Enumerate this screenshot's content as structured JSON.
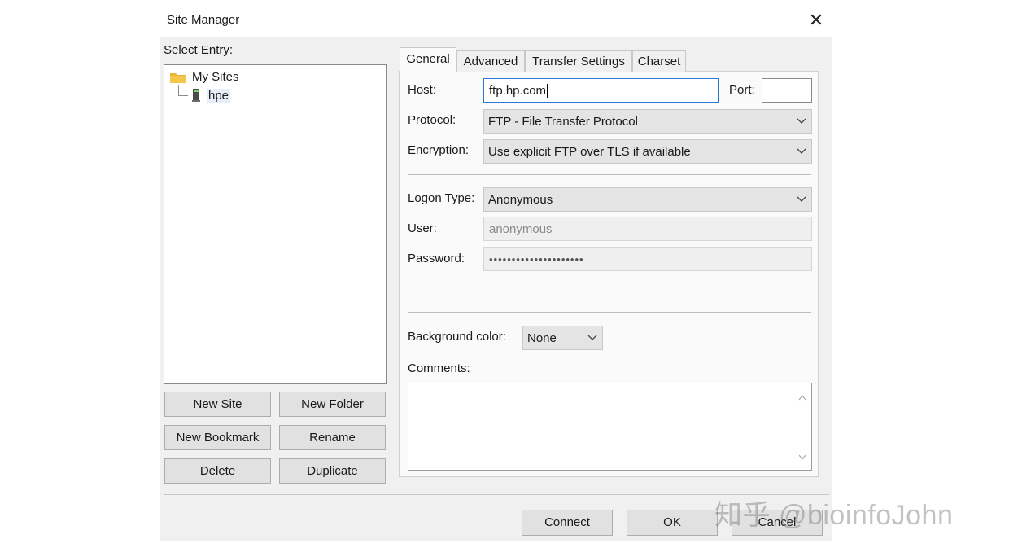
{
  "window": {
    "title": "Site Manager",
    "close_glyph": "✕"
  },
  "select_entry_label": "Select Entry:",
  "tree": [
    {
      "label": "My Sites",
      "icon": "folder-icon"
    },
    {
      "label": "hpe",
      "icon": "server-icon"
    }
  ],
  "left_buttons": {
    "new_site": "New Site",
    "new_folder": "New Folder",
    "new_bookmark": "New Bookmark",
    "rename": "Rename",
    "delete": "Delete",
    "duplicate": "Duplicate"
  },
  "tabs": [
    "General",
    "Advanced",
    "Transfer Settings",
    "Charset"
  ],
  "general": {
    "host_label": "Host:",
    "host_value": "ftp.hp.com",
    "port_label": "Port:",
    "port_value": "",
    "protocol_label": "Protocol:",
    "protocol_value": "FTP - File Transfer Protocol",
    "encryption_label": "Encryption:",
    "encryption_value": "Use explicit FTP over TLS if available",
    "logon_label": "Logon Type:",
    "logon_value": "Anonymous",
    "user_label": "User:",
    "user_value": "anonymous",
    "password_label": "Password:",
    "password_value": "•••••••••••••••••••••",
    "bgcolor_label": "Background color:",
    "bgcolor_value": "None",
    "comments_label": "Comments:",
    "comments_value": ""
  },
  "footer": {
    "connect": "Connect",
    "ok": "OK",
    "cancel": "Cancel"
  },
  "watermark": "知乎 @bioinfoJohn",
  "colors": {
    "focus_border": "#2a78d4",
    "dialog_bg": "#f0f0f0"
  }
}
